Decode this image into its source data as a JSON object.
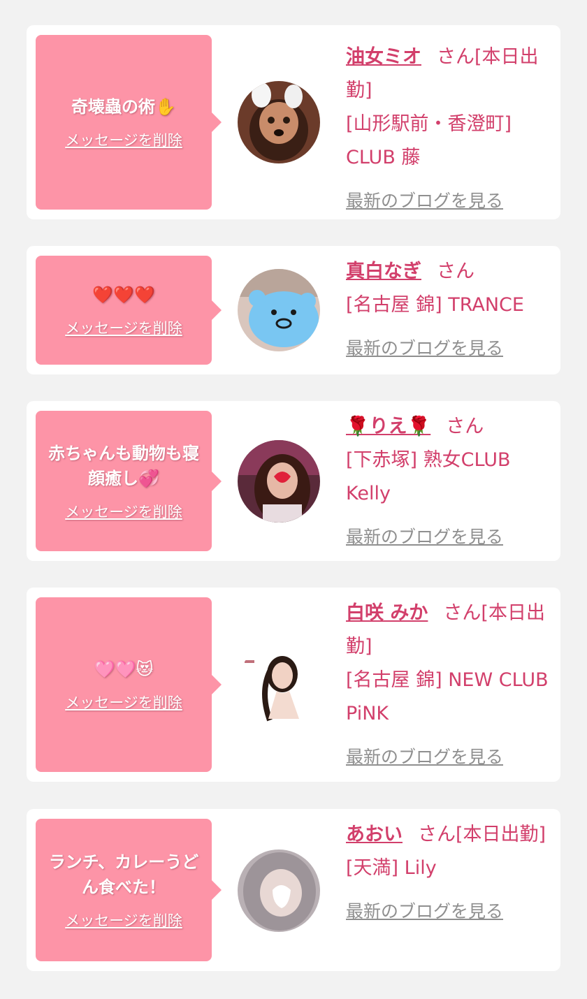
{
  "delete_label": "メッセージを削除",
  "blog_label": "最新のブログを見る",
  "colors": {
    "background": "#f2f2f2",
    "card": "#ffffff",
    "bubble": "#fd94a7",
    "name_text": "#d23f6b",
    "blog_link": "#8f8f8f"
  },
  "cards": [
    {
      "message": "奇壊蟲の術✋",
      "name": "油女ミオ",
      "honorific": "さん[本日出勤]",
      "shop": "[山形駅前・香澄町] CLUB 藤",
      "avatar": "dog-filter-photo-avatar"
    },
    {
      "message": "❤️❤️❤️",
      "name": "真白なぎ",
      "honorific": "さん",
      "shop": "[名古屋 錦] TRANCE",
      "avatar": "blue-bear-sticker-avatar"
    },
    {
      "message": "赤ちゃんも動物も寝顔癒し💞",
      "name": "🌹りえ🌹",
      "honorific": "さん",
      "shop": "[下赤塚] 熟女CLUB Kelly",
      "avatar": "heart-mask-photo-avatar"
    },
    {
      "message": "🩷🩷😻",
      "name": "白咲 みか",
      "honorific": "さん[本日出勤]",
      "shop": "[名古屋 錦] NEW CLUB PiNK",
      "avatar": "profile-photo-avatar"
    },
    {
      "message": "ランチ、カレーうどん食べた！",
      "name": "あおい",
      "honorific": "さん[本日出勤]",
      "shop": "[天満] Lily",
      "avatar": "heart-mask-photo-avatar"
    }
  ]
}
